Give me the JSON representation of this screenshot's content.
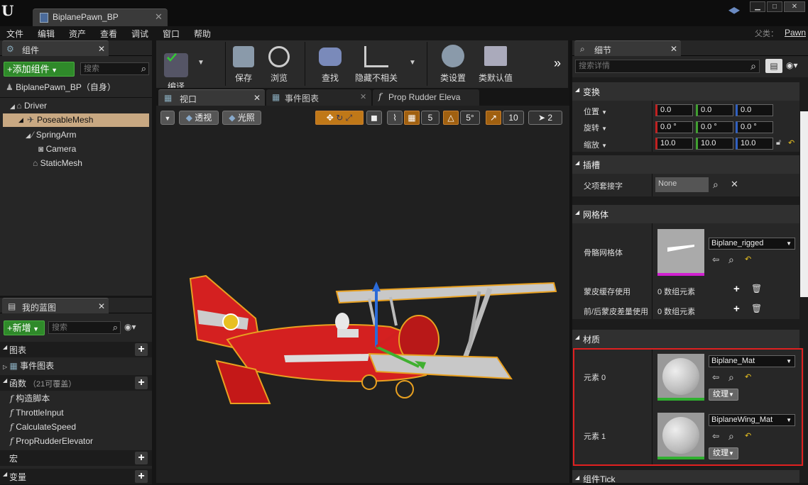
{
  "window": {
    "doc_tab": "BiplanePawn_BP",
    "parent_label": "父类：",
    "parent_value": "Pawn"
  },
  "menu": [
    "文件",
    "编辑",
    "资产",
    "查看",
    "调试",
    "窗口",
    "帮助"
  ],
  "components": {
    "tab": "组件",
    "add_button": "+添加组件",
    "search_placeholder": "搜索",
    "root": "BiplanePawn_BP（自身）",
    "tree": [
      {
        "label": "Driver"
      },
      {
        "label": "PoseableMesh"
      },
      {
        "label": "SpringArm"
      },
      {
        "label": "Camera"
      },
      {
        "label": "StaticMesh"
      }
    ]
  },
  "blueprint": {
    "tab": "我的蓝图",
    "new_button": "+新增",
    "search_placeholder": "搜索",
    "sections": {
      "graph": "图表",
      "event_graph": "事件图表",
      "functions": "函数",
      "functions_note": "（21可覆盖）",
      "macros": "宏",
      "variables": "变量"
    },
    "functions": [
      "构造脚本",
      "ThrottleInput",
      "CalculateSpeed",
      "PropRudderElevator"
    ]
  },
  "toolbar": {
    "compile": "编译",
    "save": "保存",
    "browse": "浏览",
    "find": "查找",
    "hide_unrelated": "隐藏不相关",
    "class_settings": "类设置",
    "class_defaults": "类默认值"
  },
  "editor_tabs": [
    "视口",
    "事件图表",
    "Prop Rudder Eleva"
  ],
  "viewport": {
    "perspective": "透视",
    "lit": "光照",
    "grid_snap": "5",
    "rot_snap": "5°",
    "scale_snap": "10",
    "cam_speed": "2"
  },
  "details": {
    "tab": "细节",
    "search_placeholder": "搜索详情",
    "transform": {
      "title": "变换",
      "location_label": "位置",
      "location": [
        "0.0",
        "0.0",
        "0.0"
      ],
      "rotation_label": "旋转",
      "rotation": [
        "0.0 °",
        "0.0 °",
        "0.0 °"
      ],
      "scale_label": "缩放",
      "scale": [
        "10.0",
        "10.0",
        "10.0"
      ]
    },
    "socket": {
      "title": "插槽",
      "parent_socket_label": "父项套接字",
      "parent_socket_value": "None"
    },
    "mesh": {
      "title": "网格体",
      "skeletal_label": "骨骼网格体",
      "skeletal_value": "Biplane_rigged",
      "skin_cache_label": "蒙皮缓存使用",
      "skin_cache_value": "0 数组元素",
      "morph_label": "前/后蒙皮差量使用",
      "morph_value": "0 数组元素"
    },
    "materials": {
      "title": "材质",
      "element0_label": "元素 0",
      "element0_value": "Biplane_Mat",
      "element1_label": "元素 1",
      "element1_value": "BiplaneWing_Mat",
      "texture_btn": "纹理"
    },
    "component_tick": "组件Tick"
  }
}
